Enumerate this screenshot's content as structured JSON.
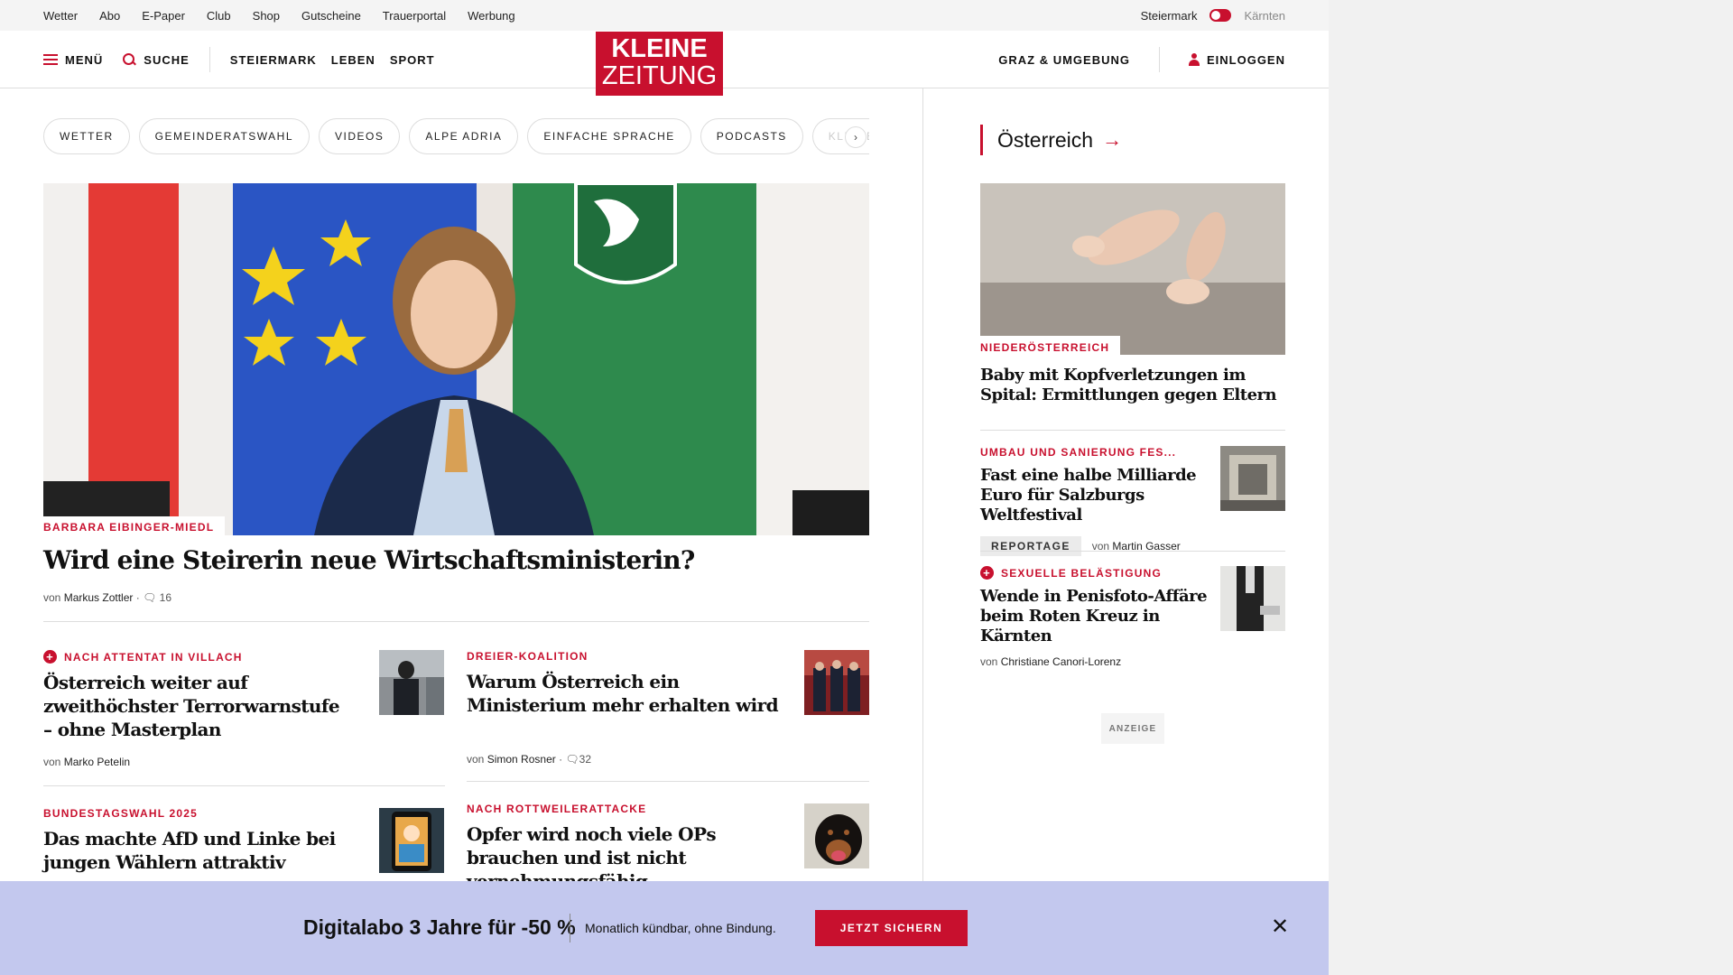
{
  "util": {
    "links": [
      "Wetter",
      "Abo",
      "E-Paper",
      "Club",
      "Shop",
      "Gutscheine",
      "Trauerportal",
      "Werbung"
    ],
    "region_active": "Steiermark",
    "region_other": "Kärnten"
  },
  "header": {
    "menu": "MENÜ",
    "search": "SUCHE",
    "sections": [
      "STEIERMARK",
      "LEBEN",
      "SPORT"
    ],
    "logo_top": "KLEINE",
    "logo_bottom": "ZEITUNG",
    "local": "GRAZ & UMGEBUNG",
    "login": "EINLOGGEN",
    "brand_color": "#c8102e"
  },
  "chips": [
    "WETTER",
    "GEMEINDERATSWAHL",
    "VIDEOS",
    "ALPE ADRIA",
    "EINFACHE SPRACHE",
    "PODCASTS",
    "KLEINE KI"
  ],
  "hero": {
    "kicker": "BARBARA EIBINGER-MIEDL",
    "title": "Wird eine Steirerin neue Wirtschaftsministerin?",
    "by": "von",
    "author": "Markus Zottler",
    "comments": "16"
  },
  "articles": [
    {
      "kicker": "NACH ATTENTAT IN VILLACH",
      "plus": true,
      "title": "Österreich weiter auf zweithöchster Terrorwarnstufe – ohne Masterplan",
      "by": "von",
      "author": "Marko Petelin",
      "comments": ""
    },
    {
      "kicker": "DREIER-KOALITION",
      "plus": false,
      "title": "Warum Österreich ein Ministerium mehr erhalten wird",
      "by": "von",
      "author": "Simon Rosner",
      "comments": "32"
    },
    {
      "kicker": "BUNDESTAGSWAHL 2025",
      "plus": false,
      "title": "Das machte AfD und Linke bei jungen Wählern attraktiv"
    },
    {
      "kicker": "NACH ROTTWEILERATTACKE",
      "plus": false,
      "title": "Opfer wird noch viele OPs brauchen und ist nicht vernehmungsfähig"
    }
  ],
  "side": {
    "heading": "Österreich",
    "items": [
      {
        "kicker": "NIEDERÖSTERREICH",
        "title": "Baby mit Kopfverletzungen im Spital: Ermittlungen gegen Eltern"
      },
      {
        "kicker": "UMBAU UND SANIERUNG FES...",
        "title": "Fast eine halbe Milliarde Euro für Salzburgs Weltfestival",
        "tag": "REPORTAGE",
        "by": "von",
        "author": "Martin Gasser"
      },
      {
        "kicker": "SEXUELLE BELÄSTIGUNG",
        "plus": true,
        "title": "Wende in Penisfoto-Affäre beim Roten Kreuz in Kärnten",
        "by": "von",
        "author": "Christiane Canori-Lorenz"
      }
    ],
    "ad_label": "ANZEIGE"
  },
  "banner": {
    "title": "Digitalabo 3 Jahre für -50 %",
    "subtitle": "Monatlich kündbar, ohne Bindung.",
    "cta": "JETZT SICHERN",
    "background": "#c3c8ee"
  }
}
